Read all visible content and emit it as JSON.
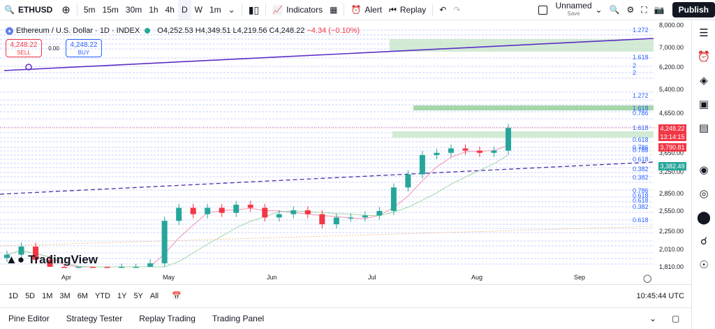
{
  "toolbar": {
    "symbol": "ETHUSD",
    "intervals": [
      "5m",
      "15m",
      "30m",
      "1h",
      "4h",
      "D",
      "W",
      "1m"
    ],
    "active_interval": "D",
    "indicators_label": "Indicators",
    "alert_label": "Alert",
    "replay_label": "Replay",
    "layout_name": "Unnamed",
    "layout_status": "Save",
    "publish_label": "Publish"
  },
  "legend": {
    "title": "Ethereum / U.S. Dollar · 1D · INDEX",
    "open": "O4,252.53",
    "high": "H4,349.51",
    "low": "L4,219.56",
    "close": "C4,248.22",
    "change": "−4.34 (−0.10%)"
  },
  "trade": {
    "sell_price": "4,248.22",
    "sell_label": "SELL",
    "spread": "0.00",
    "buy_price": "4,248.22",
    "buy_label": "BUY"
  },
  "price_axis": {
    "labels": [
      "8,000.00",
      "7,000.00",
      "6,200.00",
      "5,400.00",
      "4,650.00",
      "3,650.00",
      "3,250.00",
      "2,850.00",
      "2,550.00",
      "2,250.00",
      "2,010.00",
      "1,810.00"
    ]
  },
  "price_tags": [
    {
      "text": "4,248.22",
      "color": "#f23645"
    },
    {
      "text": "13:14:15",
      "color": "#f23645"
    },
    {
      "text": "3,790.81",
      "color": "#f23645"
    },
    {
      "text": "3,382.49",
      "color": "#26a69a"
    }
  ],
  "fib_labels": [
    "1.272",
    "1.618",
    "2",
    "2",
    "1.272",
    "1.618",
    "0.786",
    "1.618",
    "0.618",
    "0.786",
    "0.786",
    "0.618",
    "0.382",
    "0.382",
    "0.786",
    "0.618",
    "0.618",
    "0.382",
    "0.618"
  ],
  "time_axis": [
    "Apr",
    "May",
    "Jun",
    "Jul",
    "Aug",
    "Sep"
  ],
  "ranges": [
    "1D",
    "5D",
    "1M",
    "3M",
    "6M",
    "YTD",
    "1Y",
    "5Y",
    "All"
  ],
  "clock": "10:45:44 UTC",
  "panels": [
    "Pine Editor",
    "Strategy Tester",
    "Replay Trading",
    "Trading Panel"
  ],
  "brand": "TradingView",
  "colors": {
    "up": "#26a69a",
    "down": "#f23645",
    "accent": "#2962ff",
    "trendline": "#5b2ec6",
    "zone": "#c8e6c9"
  },
  "icons": {
    "right_bar": [
      "watchlist-icon",
      "alerts-clock-icon",
      "layers-icon",
      "chat-icon",
      "calendar-icon",
      "signal-icon",
      "ideas-icon",
      "apps-icon",
      "notifications-icon",
      "help-icon"
    ]
  },
  "chart_data": {
    "type": "candlestick",
    "symbol": "ETHUSD",
    "interval": "1D",
    "x": [
      "Mar-25",
      "Mar-29",
      "Apr-02",
      "Apr-06",
      "Apr-10",
      "Apr-14",
      "Apr-18",
      "Apr-22",
      "Apr-26",
      "Apr-30",
      "May-04",
      "May-08",
      "May-12",
      "May-16",
      "May-20",
      "May-24",
      "May-28",
      "Jun-01",
      "Jun-05",
      "Jun-09",
      "Jun-13",
      "Jun-17",
      "Jun-21",
      "Jun-25",
      "Jun-29",
      "Jul-03",
      "Jul-07",
      "Jul-11",
      "Jul-15",
      "Jul-19",
      "Jul-23",
      "Jul-27",
      "Jul-31",
      "Aug-04",
      "Aug-08",
      "Aug-10"
    ],
    "close": [
      1950,
      2050,
      1890,
      1800,
      1590,
      1620,
      1590,
      1580,
      1800,
      1800,
      1850,
      2400,
      2600,
      2500,
      2600,
      2520,
      2650,
      2600,
      2450,
      2500,
      2560,
      2500,
      2350,
      2450,
      2450,
      2480,
      2550,
      2950,
      3200,
      3600,
      3650,
      3750,
      3700,
      3650,
      3700,
      4248
    ],
    "ylim": [
      1750,
      8200
    ],
    "yscale": "log"
  }
}
